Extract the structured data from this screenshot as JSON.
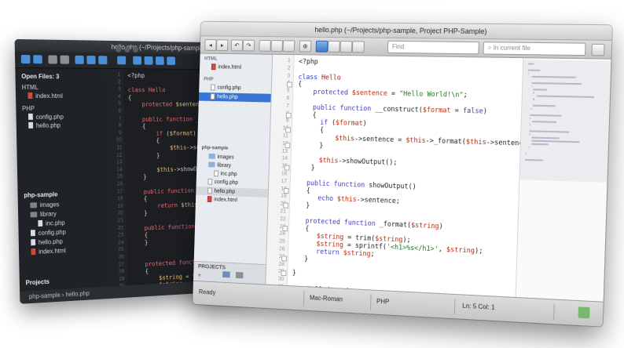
{
  "dark_window": {
    "title": "hello.php (~/Projects/php-sample, Project PHP-Sample)",
    "open_files_label": "Open Files: 3",
    "groups": [
      {
        "label": "HTML",
        "files": [
          "index.html"
        ]
      },
      {
        "label": "PHP",
        "files": [
          "config.php",
          "hello.php"
        ]
      }
    ],
    "project_name": "php-sample",
    "tree": [
      "images",
      "library",
      "inc.php",
      "config.php",
      "hello.php",
      "index.html"
    ],
    "projects_label": "Projects",
    "status": "php-sample  ›  hello.php",
    "code_lines": [
      "<?php",
      "",
      "class Hello",
      "{",
      "    protected $sentence = \"Hello World!\\n\";",
      "",
      "    public function __construct($format = false)",
      "    {",
      "        if ($format)",
      "        {",
      "            $this->sentence = $this->_format($this->sentence);",
      "        }",
      "",
      "        $this->showOutput();",
      "    }",
      "",
      "    public function showOutput()",
      "    {",
      "        return $this->sentence;",
      "    }",
      "",
      "    public function format($string)",
      "    {",
      "    }",
      "",
      "",
      "    protected function _format($string)",
      "    {",
      "        $string = trim($string);",
      "        $string = $string;",
      "        return $string;",
      "    }"
    ]
  },
  "light_window": {
    "title": "hello.php (~/Projects/php-sample, Project PHP-Sample)",
    "find_placeholder": "Find",
    "scope_placeholder": "In current file",
    "sidebar": {
      "group_html": "HTML",
      "html_files": [
        "index.html"
      ],
      "group_php": "PHP",
      "php_files": [
        "config.php",
        "hello.php"
      ],
      "project_name": "php-sample",
      "tree": [
        "images",
        "library",
        "inc.php",
        "config.php",
        "hello.php",
        "index.html"
      ],
      "footer_label": "PROJECTS"
    },
    "code_lines": [
      "<?php",
      "",
      "class Hello",
      "{",
      "    protected $sentence = \"Hello World!\\n\";",
      "",
      "    public function __construct($format = false)",
      "    {",
      "      if ($format)",
      "      {",
      "          $this->sentence = $this->_format($this->sentence);",
      "      }",
      "",
      "      $this->showOutput();",
      "    }",
      "",
      "   public function showOutput()",
      "   {",
      "      echo $this->sentence;",
      "   }",
      "",
      "   protected function _format($string)",
      "   {",
      "      $string = trim($string);",
      "      $string = sprintf('<h1>%s</h1>', $string);",
      "      return $string;",
      "   }",
      "",
      "}",
      "",
      "new Hello(true);"
    ],
    "status": {
      "ready": "Ready",
      "encoding": "Mac-Roman",
      "language": "PHP",
      "position": "Ln: 5 Col: 1"
    },
    "colors": {
      "accent": "#3875d7",
      "keyword": "#3d3dbf",
      "class": "#9b1717",
      "string": "#1d7a1d"
    }
  }
}
